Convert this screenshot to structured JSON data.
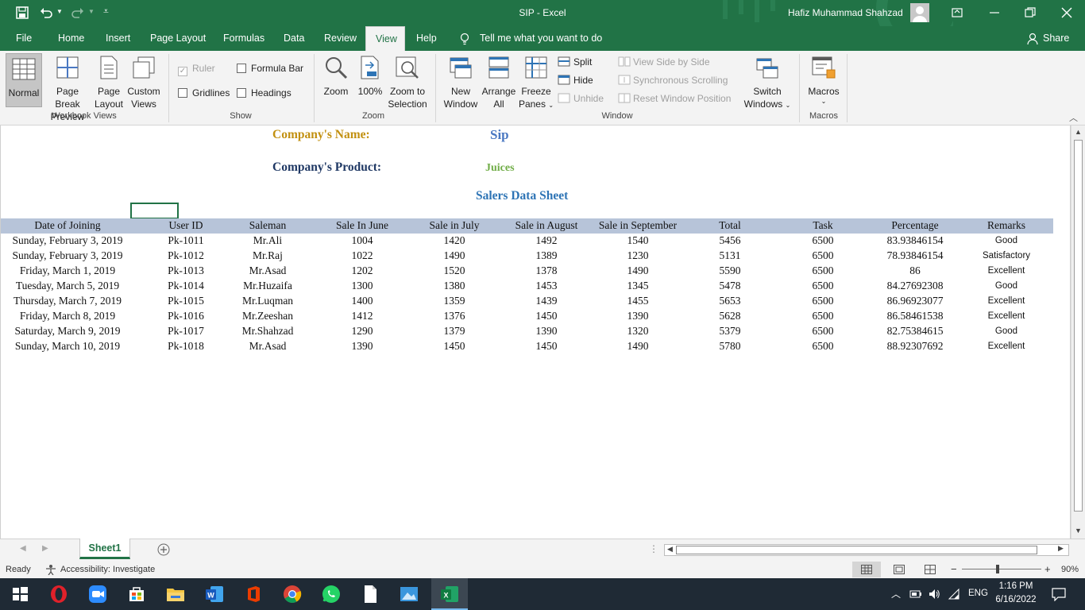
{
  "titlebar": {
    "doc_title": "SIP  -  Excel",
    "user_name": "Hafiz Muhammad Shahzad"
  },
  "tabs": [
    "File",
    "Home",
    "Insert",
    "Page Layout",
    "Formulas",
    "Data",
    "Review",
    "View",
    "Help"
  ],
  "active_tab": "View",
  "tell_me": "Tell me what you want to do",
  "share_label": "Share",
  "ribbon": {
    "workbook_views": {
      "label": "Workbook Views",
      "normal": "Normal",
      "page_break_1": "Page Break",
      "page_break_2": "Preview",
      "page_layout_1": "Page",
      "page_layout_2": "Layout",
      "custom_1": "Custom",
      "custom_2": "Views"
    },
    "show": {
      "label": "Show",
      "ruler": "Ruler",
      "formula_bar": "Formula Bar",
      "gridlines": "Gridlines",
      "headings": "Headings"
    },
    "zoom": {
      "label": "Zoom",
      "zoom": "Zoom",
      "hundred": "100%",
      "zoom_sel_1": "Zoom to",
      "zoom_sel_2": "Selection"
    },
    "window": {
      "label": "Window",
      "new_1": "New",
      "new_2": "Window",
      "arrange_1": "Arrange",
      "arrange_2": "All",
      "freeze_1": "Freeze",
      "freeze_2": "Panes",
      "split": "Split",
      "hide": "Hide",
      "unhide": "Unhide",
      "side_by_side": "View Side by Side",
      "sync_scroll": "Synchronous Scrolling",
      "reset_pos": "Reset Window Position",
      "switch_1": "Switch",
      "switch_2": "Windows"
    },
    "macros": {
      "label": "Macros",
      "macros": "Macros"
    }
  },
  "sheet": {
    "company_name_label": "Company's Name:",
    "company_name_value": "Sip",
    "company_product_label": "Company's Product:",
    "company_product_value": "Juices",
    "sheet_title": "Salers Data Sheet",
    "headers": [
      "Date of Joining",
      "User ID",
      "Saleman",
      "Sale In June",
      "Sale in July",
      "Sale in August",
      "Sale in September",
      "Total",
      "Task",
      "Percentage",
      "Remarks"
    ],
    "rows": [
      [
        "Sunday, February 3, 2019",
        "Pk-1011",
        "Mr.Ali",
        "1004",
        "1420",
        "1492",
        "1540",
        "5456",
        "6500",
        "83.93846154",
        "Good"
      ],
      [
        "Sunday, February 3, 2019",
        "Pk-1012",
        "Mr.Raj",
        "1022",
        "1490",
        "1389",
        "1230",
        "5131",
        "6500",
        "78.93846154",
        "Satisfactory"
      ],
      [
        "Friday, March 1, 2019",
        "Pk-1013",
        "Mr.Asad",
        "1202",
        "1520",
        "1378",
        "1490",
        "5590",
        "6500",
        "86",
        "Excellent"
      ],
      [
        "Tuesday, March 5, 2019",
        "Pk-1014",
        "Mr.Huzaifa",
        "1300",
        "1380",
        "1453",
        "1345",
        "5478",
        "6500",
        "84.27692308",
        "Good"
      ],
      [
        "Thursday, March 7, 2019",
        "Pk-1015",
        "Mr.Luqman",
        "1400",
        "1359",
        "1439",
        "1455",
        "5653",
        "6500",
        "86.96923077",
        "Excellent"
      ],
      [
        "Friday, March 8, 2019",
        "Pk-1016",
        "Mr.Zeeshan",
        "1412",
        "1376",
        "1450",
        "1390",
        "5628",
        "6500",
        "86.58461538",
        "Excellent"
      ],
      [
        "Saturday, March 9, 2019",
        "Pk-1017",
        "Mr.Shahzad",
        "1290",
        "1379",
        "1390",
        "1320",
        "5379",
        "6500",
        "82.75384615",
        "Good"
      ],
      [
        "Sunday, March 10, 2019",
        "Pk-1018",
        "Mr.Asad",
        "1390",
        "1450",
        "1450",
        "1490",
        "5780",
        "6500",
        "88.92307692",
        "Excellent"
      ]
    ]
  },
  "sheet_tab": "Sheet1",
  "status": {
    "ready": "Ready",
    "accessibility": "Accessibility: Investigate",
    "zoom": "90%"
  },
  "taskbar": {
    "lang": "ENG",
    "time": "1:16 PM",
    "date": "6/16/2022"
  },
  "colors": {
    "excel_green": "#217346",
    "company_label": "#c29010",
    "company_value": "#4a78c2",
    "product_label": "#1f3864",
    "product_value": "#70ad47",
    "sheet_title": "#2e74b5",
    "header_fill": "#b7c4d9"
  }
}
